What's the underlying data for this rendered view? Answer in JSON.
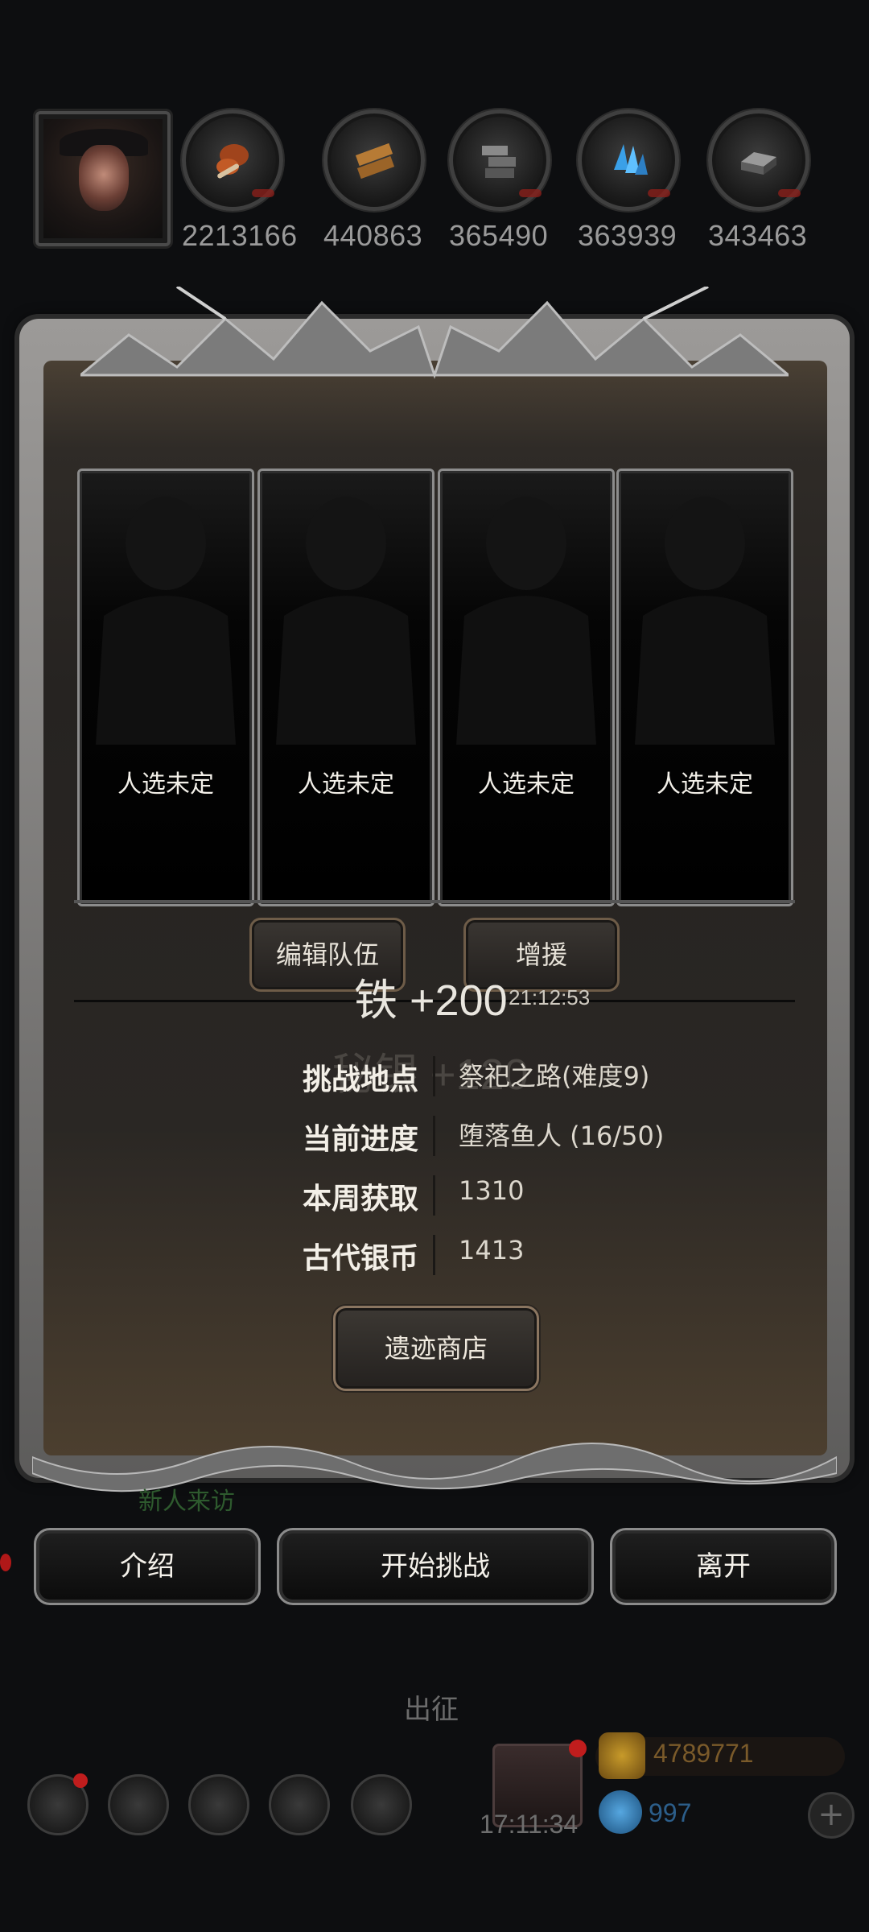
{
  "resources": [
    {
      "name": "meat-icon",
      "value": "2213166"
    },
    {
      "name": "wood-icon",
      "value": "440863"
    },
    {
      "name": "stone-icon",
      "value": "365490"
    },
    {
      "name": "crystal-icon",
      "value": "363939"
    },
    {
      "name": "iron-icon",
      "value": "343463"
    }
  ],
  "team": {
    "slots": [
      "人选未定",
      "人选未定",
      "人选未定",
      "人选未定"
    ],
    "edit_label": "编辑队伍",
    "reinforce_label": "增援"
  },
  "float_text": {
    "iron_gain": "铁 +200",
    "faded_gain": "秘银 +120",
    "timer": "21:12:53"
  },
  "info": {
    "location_key": "挑战地点",
    "location_val": "祭祀之路(难度9)",
    "progress_key": "当前进度",
    "progress_val": "堕落鱼人 (16/50)",
    "weekly_key": "本周获取",
    "weekly_val": "1310",
    "coin_key": "古代银币",
    "coin_val": "1413"
  },
  "shop_label": "遗迹商店",
  "visitor_text": "新人来访",
  "actions": {
    "intro": "介绍",
    "start": "开始挑战",
    "leave": "离开"
  },
  "bottom": {
    "depart": "出征",
    "clock": "17:11:34",
    "gold": "4789771",
    "gems": "997",
    "plus": "+"
  }
}
